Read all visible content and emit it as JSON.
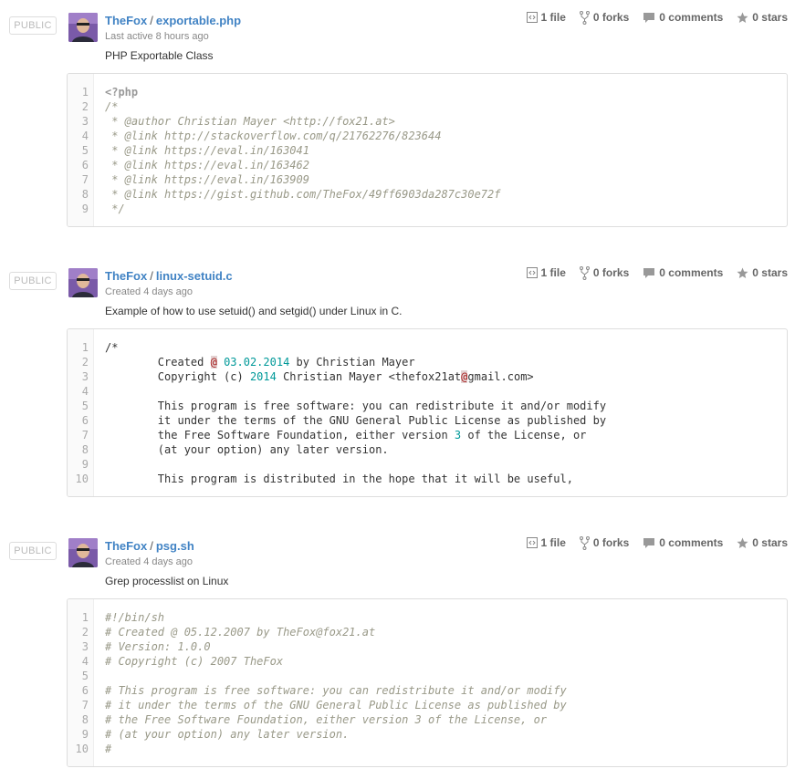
{
  "gists": [
    {
      "badge": "PUBLIC",
      "owner": "TheFox",
      "separator": "/",
      "filename": "exportable.php",
      "time": "Last active 8 hours ago",
      "description": "PHP Exportable Class",
      "files": "1 file",
      "forks": "0 forks",
      "comments": "0 comments",
      "stars": "0 stars",
      "lines": [
        {
          "n": "1",
          "segs": [
            {
              "t": "<?php",
              "c": "c-php"
            }
          ]
        },
        {
          "n": "2",
          "segs": [
            {
              "t": "/*",
              "c": "c-comment"
            }
          ]
        },
        {
          "n": "3",
          "segs": [
            {
              "t": " * @author Christian Mayer <http://fox21.at>",
              "c": "c-comment"
            }
          ]
        },
        {
          "n": "4",
          "segs": [
            {
              "t": " * @link http://stackoverflow.com/q/21762276/823644",
              "c": "c-comment"
            }
          ]
        },
        {
          "n": "5",
          "segs": [
            {
              "t": " * @link https://eval.in/163041",
              "c": "c-comment"
            }
          ]
        },
        {
          "n": "6",
          "segs": [
            {
              "t": " * @link https://eval.in/163462",
              "c": "c-comment"
            }
          ]
        },
        {
          "n": "7",
          "segs": [
            {
              "t": " * @link https://eval.in/163909",
              "c": "c-comment"
            }
          ]
        },
        {
          "n": "8",
          "segs": [
            {
              "t": " * @link https://gist.github.com/TheFox/49ff6903da287c30e72f",
              "c": "c-comment"
            }
          ]
        },
        {
          "n": "9",
          "segs": [
            {
              "t": " */",
              "c": "c-comment"
            }
          ]
        }
      ]
    },
    {
      "badge": "PUBLIC",
      "owner": "TheFox",
      "separator": "/",
      "filename": "linux-setuid.c",
      "time": "Created 4 days ago",
      "description": "Example of how to use setuid() and setgid() under Linux in C.",
      "files": "1 file",
      "forks": "0 forks",
      "comments": "0 comments",
      "stars": "0 stars",
      "lines": [
        {
          "n": "1",
          "segs": [
            {
              "t": "/*",
              "c": "c-plain"
            }
          ]
        },
        {
          "n": "2",
          "segs": [
            {
              "t": "        Created ",
              "c": "c-plain"
            },
            {
              "t": "@",
              "c": "c-err"
            },
            {
              "t": " ",
              "c": "c-plain"
            },
            {
              "t": "03.02.2014",
              "c": "c-num"
            },
            {
              "t": " by Christian Mayer",
              "c": "c-plain"
            }
          ]
        },
        {
          "n": "3",
          "segs": [
            {
              "t": "        Copyright (c) ",
              "c": "c-plain"
            },
            {
              "t": "2014",
              "c": "c-num"
            },
            {
              "t": " Christian Mayer <thefox21at",
              "c": "c-plain"
            },
            {
              "t": "@",
              "c": "c-err"
            },
            {
              "t": "gmail.com>",
              "c": "c-plain"
            }
          ]
        },
        {
          "n": "4",
          "segs": [
            {
              "t": "",
              "c": "c-plain"
            }
          ]
        },
        {
          "n": "5",
          "segs": [
            {
              "t": "        This program is free software: you can redistribute it and/or modify",
              "c": "c-plain"
            }
          ]
        },
        {
          "n": "6",
          "segs": [
            {
              "t": "        it under the terms of the GNU General Public License as published by",
              "c": "c-plain"
            }
          ]
        },
        {
          "n": "7",
          "segs": [
            {
              "t": "        the Free Software Foundation, either version ",
              "c": "c-plain"
            },
            {
              "t": "3",
              "c": "c-num"
            },
            {
              "t": " of the License, or",
              "c": "c-plain"
            }
          ]
        },
        {
          "n": "8",
          "segs": [
            {
              "t": "        (at your option) any later version.",
              "c": "c-plain"
            }
          ]
        },
        {
          "n": "9",
          "segs": [
            {
              "t": "",
              "c": "c-plain"
            }
          ]
        },
        {
          "n": "10",
          "segs": [
            {
              "t": "        This program is distributed in the hope that it will be useful,",
              "c": "c-plain"
            }
          ]
        }
      ]
    },
    {
      "badge": "PUBLIC",
      "owner": "TheFox",
      "separator": "/",
      "filename": "psg.sh",
      "time": "Created 4 days ago",
      "description": "Grep processlist on Linux",
      "files": "1 file",
      "forks": "0 forks",
      "comments": "0 comments",
      "stars": "0 stars",
      "lines": [
        {
          "n": "1",
          "segs": [
            {
              "t": "#!/bin/sh",
              "c": "c-comment"
            }
          ]
        },
        {
          "n": "2",
          "segs": [
            {
              "t": "# Created @ 05.12.2007 by TheFox@fox21.at",
              "c": "c-comment"
            }
          ]
        },
        {
          "n": "3",
          "segs": [
            {
              "t": "# Version: 1.0.0",
              "c": "c-comment"
            }
          ]
        },
        {
          "n": "4",
          "segs": [
            {
              "t": "# Copyright (c) 2007 TheFox",
              "c": "c-comment"
            }
          ]
        },
        {
          "n": "5",
          "segs": [
            {
              "t": "",
              "c": "c-comment"
            }
          ]
        },
        {
          "n": "6",
          "segs": [
            {
              "t": "# This program is free software: you can redistribute it and/or modify",
              "c": "c-comment"
            }
          ]
        },
        {
          "n": "7",
          "segs": [
            {
              "t": "# it under the terms of the GNU General Public License as published by",
              "c": "c-comment"
            }
          ]
        },
        {
          "n": "8",
          "segs": [
            {
              "t": "# the Free Software Foundation, either version 3 of the License, or",
              "c": "c-comment"
            }
          ]
        },
        {
          "n": "9",
          "segs": [
            {
              "t": "# (at your option) any later version.",
              "c": "c-comment"
            }
          ]
        },
        {
          "n": "10",
          "segs": [
            {
              "t": "#",
              "c": "c-comment"
            }
          ]
        }
      ]
    }
  ],
  "icons": {
    "file": "code-file-icon",
    "fork": "fork-icon",
    "comment": "comment-icon",
    "star": "star-icon",
    "avatar": "avatar"
  },
  "colors": {
    "link": "#4183c4",
    "meta": "#888888",
    "border": "#dddddd"
  }
}
